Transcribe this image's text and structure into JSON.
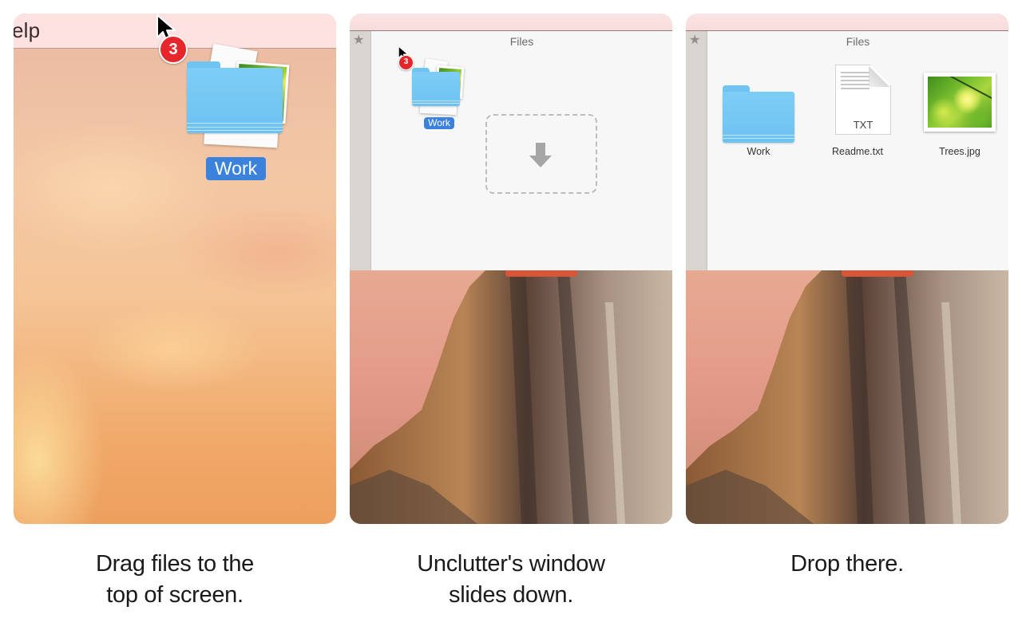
{
  "steps": [
    {
      "caption": "Drag files to the\ntop of screen.",
      "menubar_text": "elp",
      "drag": {
        "badge_count": "3",
        "label": "Work"
      }
    },
    {
      "caption": "Unclutter's window\nslides down.",
      "window_title": "Files",
      "drag": {
        "badge_count": "3",
        "label": "Work"
      },
      "dropzone_icon": "down-arrow-icon"
    },
    {
      "caption": "Drop there.",
      "window_title": "Files",
      "files": [
        {
          "name": "Work",
          "icon": "folder-icon"
        },
        {
          "name": "Readme.txt",
          "icon": "text-document-icon",
          "ext": "TXT"
        },
        {
          "name": "Trees.jpg",
          "icon": "image-thumbnail-icon"
        }
      ]
    }
  ],
  "colors": {
    "selection": "#3b82dd",
    "badge": "#e6262b",
    "folder": "#74c8f4",
    "dock_accent": "#d9553a"
  }
}
